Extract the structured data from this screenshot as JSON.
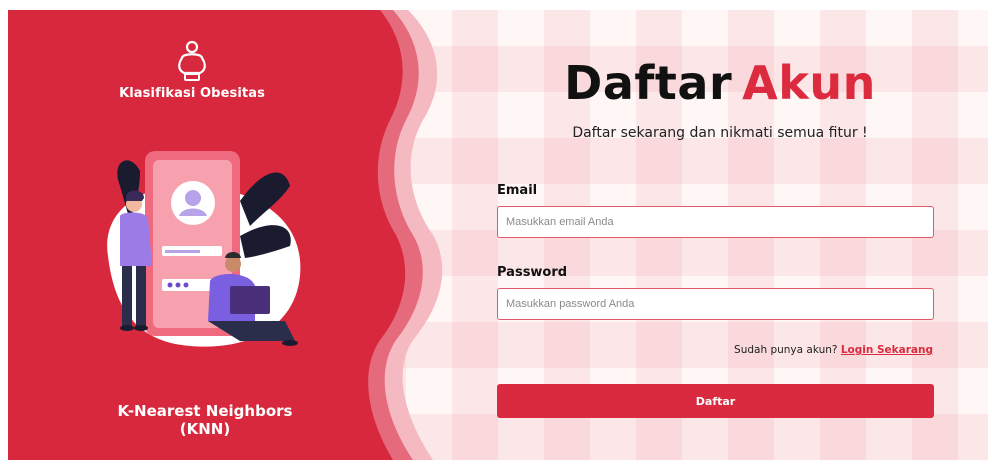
{
  "brand": {
    "title": "Klasifikasi Obesitas",
    "icon": "person-scale-icon"
  },
  "left_footer": "K-Nearest Neighbors (KNN)",
  "form": {
    "title_part1": "Daftar",
    "title_part2": "Akun",
    "subtitle": "Daftar sekarang dan nikmati semua fitur !",
    "email_label": "Email",
    "email_placeholder": "Masukkan email Anda",
    "password_label": "Password",
    "password_placeholder": "Masukkan password Anda",
    "login_prompt": "Sudah punya akun?",
    "login_link": "Login Sekarang",
    "submit_label": "Daftar"
  },
  "colors": {
    "accent": "#dc2a3e",
    "panel": "#d8283d"
  }
}
